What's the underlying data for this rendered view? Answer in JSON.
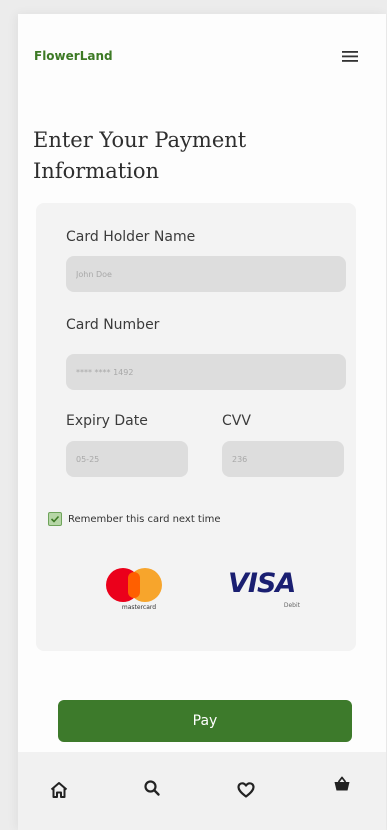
{
  "app": {
    "brand": "FlowerLand"
  },
  "page": {
    "title": "Enter Your Payment Information"
  },
  "form": {
    "card_holder": {
      "label": "Card Holder Name",
      "placeholder": "John Doe"
    },
    "card_number": {
      "label": "Card Number",
      "placeholder": "**** **** 1492"
    },
    "expiry": {
      "label": "Expiry Date",
      "placeholder": "05-25"
    },
    "cvv": {
      "label": "CVV",
      "placeholder": "236"
    },
    "remember": {
      "label": "Remember this card next time",
      "checked": true
    }
  },
  "payment_methods": {
    "mastercard_label": "mastercard",
    "visa_label": "VISA",
    "visa_sub": "Debit"
  },
  "actions": {
    "pay_label": "Pay"
  },
  "bottom_nav": {
    "items": [
      "home-icon",
      "search-icon",
      "heart-icon",
      "basket-icon"
    ]
  },
  "colors": {
    "brand_green": "#3d7a25",
    "pay_button": "#3d7a2b",
    "mastercard_red": "#eb001b",
    "mastercard_yellow": "#f79e1b",
    "visa_blue": "#1a1f71"
  }
}
